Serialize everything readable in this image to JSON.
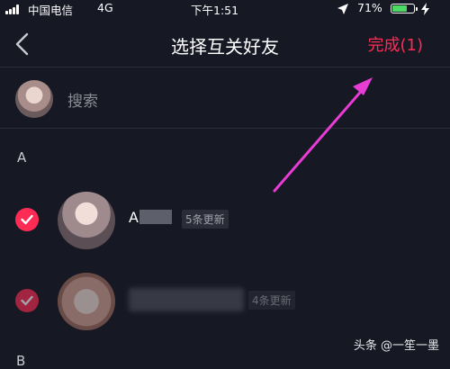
{
  "status_bar": {
    "carrier": "中国电信",
    "network": "4G",
    "time": "下午1:51",
    "battery": "71%",
    "battery_level": 0.71,
    "battery_color": "#4cd964",
    "icons": [
      "signal-icon",
      "location-arrow-icon",
      "battery-icon",
      "charging-icon"
    ]
  },
  "nav": {
    "back_icon": "chevron-left-icon",
    "title": "选择互关好友",
    "done_label": "完成(1)",
    "accent_color": "#fe2c55"
  },
  "search": {
    "placeholder": "搜索"
  },
  "sections": [
    {
      "header": "A"
    },
    {
      "header": "B"
    }
  ],
  "friends": [
    {
      "name": "A",
      "badge": "5条更新",
      "selected": true
    },
    {
      "name": "",
      "badge": "4条更新",
      "selected": true
    }
  ],
  "watermark": "头条 @一笙一墨",
  "annotation_color": "#e83cd4"
}
